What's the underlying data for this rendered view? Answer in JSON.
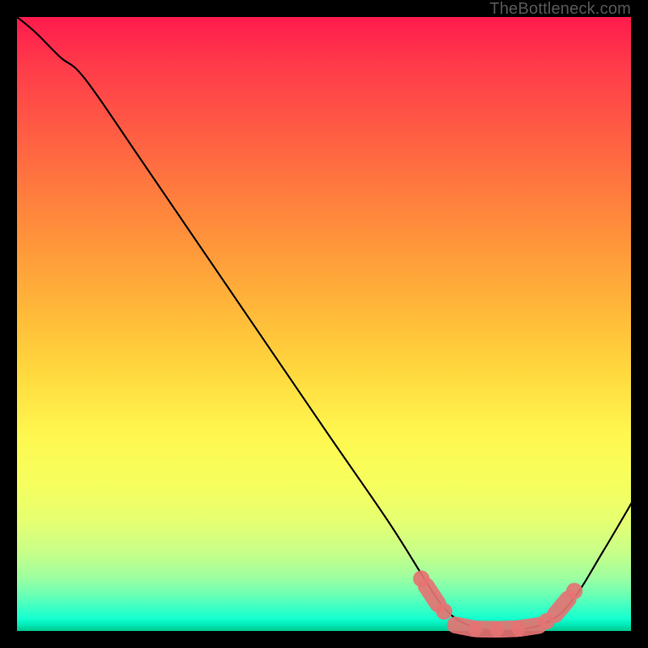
{
  "watermark": "TheBottleneck.com",
  "chart_data": {
    "type": "line",
    "title": "",
    "xlabel": "",
    "ylabel": "",
    "xlim": [
      0,
      100
    ],
    "ylim": [
      0,
      100
    ],
    "grid": false,
    "curve_points": [
      {
        "x": 0,
        "y": 100
      },
      {
        "x": 3,
        "y": 97.5
      },
      {
        "x": 7,
        "y": 93.5
      },
      {
        "x": 11,
        "y": 90
      },
      {
        "x": 20,
        "y": 77
      },
      {
        "x": 35,
        "y": 55
      },
      {
        "x": 50,
        "y": 33
      },
      {
        "x": 60,
        "y": 18.5
      },
      {
        "x": 66,
        "y": 9
      },
      {
        "x": 69,
        "y": 4.5
      },
      {
        "x": 72,
        "y": 2
      },
      {
        "x": 76,
        "y": 0.7
      },
      {
        "x": 81,
        "y": 0.7
      },
      {
        "x": 86,
        "y": 2
      },
      {
        "x": 90,
        "y": 5.5
      },
      {
        "x": 95,
        "y": 13.5
      },
      {
        "x": 100,
        "y": 22
      }
    ],
    "markers": [
      {
        "type": "dot",
        "x": 65.5,
        "y": 9.0,
        "r": 0.9
      },
      {
        "type": "pill",
        "x1": 66.3,
        "y1": 7.8,
        "x2": 68.2,
        "y2": 4.9,
        "w": 1.7
      },
      {
        "type": "dot",
        "x": 69.2,
        "y": 3.7,
        "r": 0.9
      },
      {
        "type": "pill",
        "x1": 71.0,
        "y1": 1.5,
        "x2": 74.0,
        "y2": 0.9,
        "w": 1.7
      },
      {
        "type": "pill",
        "x1": 74.5,
        "y1": 0.85,
        "x2": 77.5,
        "y2": 0.8,
        "w": 1.7
      },
      {
        "type": "pill",
        "x1": 78.0,
        "y1": 0.8,
        "x2": 81.0,
        "y2": 0.9,
        "w": 1.7
      },
      {
        "type": "pill",
        "x1": 81.5,
        "y1": 0.95,
        "x2": 84.5,
        "y2": 1.4,
        "w": 1.7
      },
      {
        "type": "dot",
        "x": 85.8,
        "y": 2.1,
        "r": 0.9
      },
      {
        "type": "pill",
        "x1": 87.2,
        "y1": 3.2,
        "x2": 89.3,
        "y2": 5.7,
        "w": 1.7
      },
      {
        "type": "dot",
        "x": 90.3,
        "y": 7.0,
        "r": 0.9
      }
    ]
  }
}
